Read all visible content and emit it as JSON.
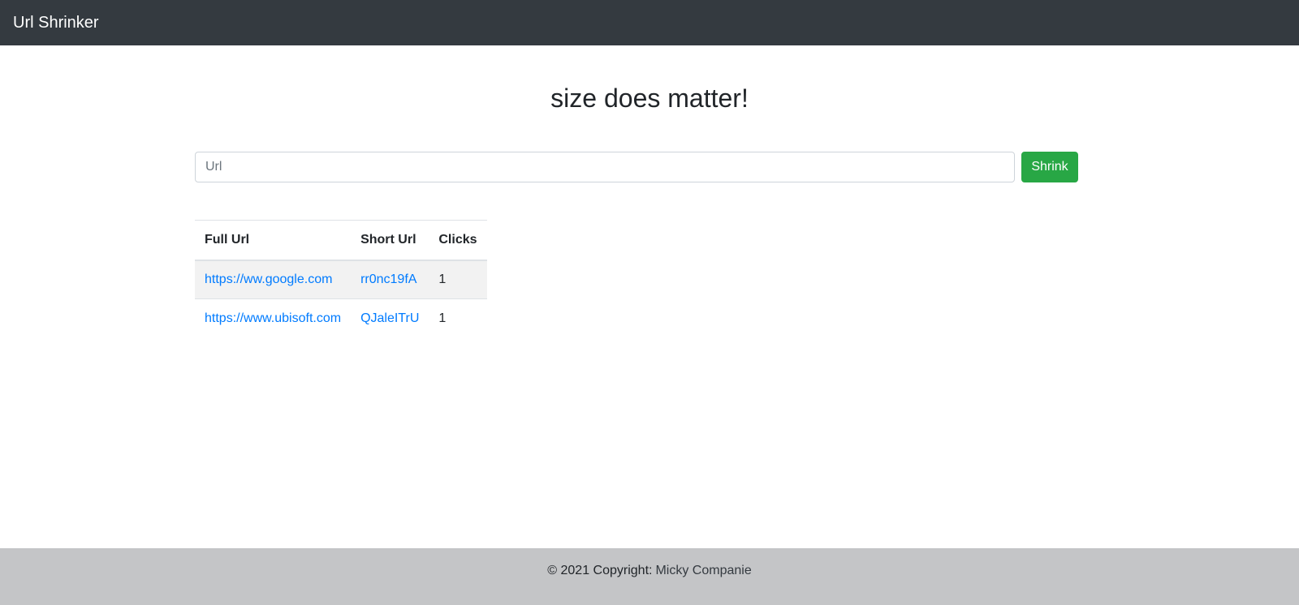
{
  "navbar": {
    "brand": "Url Shrinker"
  },
  "main": {
    "headline": "size does matter!",
    "form": {
      "url_placeholder": "Url",
      "url_value": "",
      "submit_label": "Shrink"
    },
    "table": {
      "headers": [
        "Full Url",
        "Short Url",
        "Clicks"
      ],
      "rows": [
        {
          "full_url": "https://ww.google.com",
          "short_url": "rr0nc19fA",
          "clicks": "1"
        },
        {
          "full_url": "https://www.ubisoft.com",
          "short_url": "QJaleITrU",
          "clicks": "1"
        }
      ]
    }
  },
  "footer": {
    "copyright": "© 2021 Copyright:",
    "owner": "Micky Companie"
  },
  "colors": {
    "navbar": "#343a40",
    "accent_link": "#007bff",
    "button": "#28a745",
    "footer": "#c4c5c7"
  }
}
